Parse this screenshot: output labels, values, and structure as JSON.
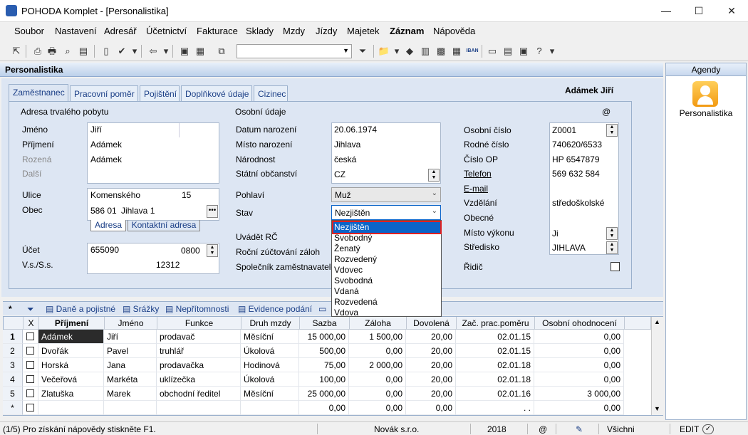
{
  "window": {
    "title": "POHODA Komplet - [Personalistika]",
    "min": "—",
    "max": "☐",
    "close": "✕"
  },
  "menu": [
    "Soubor",
    "Nastavení",
    "Adresář",
    "Účetnictví",
    "Fakturace",
    "Sklady",
    "Mzdy",
    "Jízdy",
    "Majetek",
    "Záznam",
    "Nápověda"
  ],
  "agenda_title": "Personalistika",
  "tabs": [
    "Zaměstnanec",
    "Pracovní poměr",
    "Pojištění",
    "Doplňkové údaje",
    "Cizinec"
  ],
  "record_name": "Adámek Jiří",
  "address": {
    "section": "Adresa trvalého pobytu",
    "jmeno_lbl": "Jméno",
    "jmeno": "Jiří",
    "prijmeni_lbl": "Příjmení",
    "prijmeni": "Adámek",
    "rozena_lbl": "Rozená",
    "rozena": "Adámek",
    "dalsi_lbl": "Další",
    "ulice_lbl": "Ulice",
    "ulice": "Komenského",
    "cislo": "15",
    "obec_lbl": "Obec",
    "psc": "586 01",
    "obec": "Jihlava 1",
    "subtab1": "Adresa",
    "subtab2": "Kontaktní adresa",
    "ucet_lbl": "Účet",
    "ucet": "655090",
    "kod_banky": "0800",
    "vs_lbl": "V.s./S.s.",
    "ss": "12312"
  },
  "personal": {
    "section": "Osobní údaje",
    "at": "@",
    "dn_lbl": "Datum narození",
    "dn": "20.06.1974",
    "mn_lbl": "Místo narození",
    "mn": "Jihlava",
    "nar_lbl": "Národnost",
    "nar": "česká",
    "so_lbl": "Státní občanství",
    "so": "CZ",
    "pohl_lbl": "Pohlaví",
    "pohl": "Muž",
    "stav_lbl": "Stav",
    "stav": "Nezjištěn",
    "rc_lbl": "Uvádět RČ",
    "rz_lbl": "Roční zúčtování záloh",
    "sz_lbl": "Společník zaměstnavatele"
  },
  "stav_options": [
    "Nezjištěn",
    "Svobodný",
    "Ženatý",
    "Rozvedený",
    "Vdovec",
    "Svobodná",
    "Vdaná",
    "Rozvedená",
    "Vdova"
  ],
  "right": {
    "oc_lbl": "Osobní číslo",
    "oc": "Z0001",
    "rc_lbl": "Rodné číslo",
    "rc": "740620/6533",
    "op_lbl": "Číslo OP",
    "op": "HP 6547879",
    "tel_lbl": "Telefon",
    "tel": "569 632 584",
    "email_lbl": "E-mail",
    "vzd_lbl": "Vzdělání",
    "vzd": "středoškolské",
    "obecne_lbl": "Obecné",
    "mv_lbl": "Místo výkonu",
    "mv": "Ji",
    "str_lbl": "Středisko",
    "str": "JIHLAVA",
    "ridic_lbl": "Řidič"
  },
  "subagendas": [
    "Daně a pojistné",
    "Srážky",
    "Nepřítomnosti",
    "Evidence podání"
  ],
  "grid": {
    "columns": [
      "X",
      "Příjmení",
      "Jméno",
      "Funkce",
      "Druh mzdy",
      "Sazba",
      "Záloha",
      "Dovolená",
      "Zač. prac.poměru",
      "Osobní ohodnocení"
    ],
    "rows": [
      [
        "1",
        "Adámek",
        "Jiří",
        "prodavač",
        "Měsíční",
        "15 000,00",
        "1 500,00",
        "20,00",
        "02.01.15",
        "0,00"
      ],
      [
        "2",
        "Dvořák",
        "Pavel",
        "truhlář",
        "Úkolová",
        "500,00",
        "0,00",
        "20,00",
        "02.01.15",
        "0,00"
      ],
      [
        "3",
        "Horská",
        "Jana",
        "prodavačka",
        "Hodinová",
        "75,00",
        "2 000,00",
        "20,00",
        "02.01.18",
        "0,00"
      ],
      [
        "4",
        "Večeřová",
        "Markéta",
        "uklízečka",
        "Úkolová",
        "100,00",
        "0,00",
        "20,00",
        "02.01.18",
        "0,00"
      ],
      [
        "5",
        "Zlatuška",
        "Marek",
        "obchodní ředitel",
        "Měsíční",
        "25 000,00",
        "0,00",
        "20,00",
        "02.01.16",
        "3 000,00"
      ],
      [
        "*",
        "",
        "",
        "",
        "",
        "0,00",
        "0,00",
        "0,00",
        ". .",
        "0,00"
      ]
    ]
  },
  "status": {
    "hint": "(1/5) Pro získání nápovědy stiskněte F1.",
    "company": "Novák s.r.o.",
    "year": "2018",
    "filter": "Všichni",
    "mode": "EDIT"
  },
  "agendy": {
    "title": "Agendy",
    "item": "Personalistika"
  }
}
